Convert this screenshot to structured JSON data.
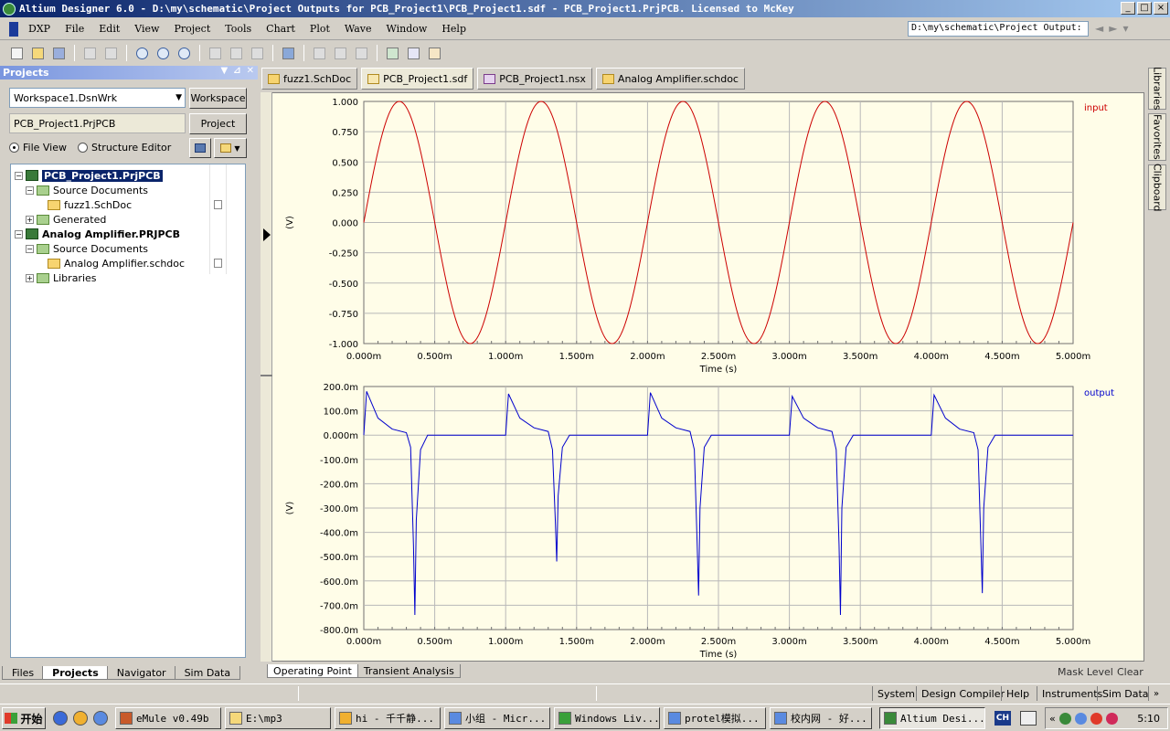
{
  "window": {
    "title": "Altium Designer 6.0 - D:\\my\\schematic\\Project Outputs for PCB_Project1\\PCB_Project1.sdf - PCB_Project1.PrjPCB. Licensed to McKey",
    "controls": [
      "_",
      "□",
      "×"
    ]
  },
  "menubar": {
    "items": [
      "DXP",
      "File",
      "Edit",
      "View",
      "Project",
      "Tools",
      "Chart",
      "Plot",
      "Wave",
      "Window",
      "Help"
    ],
    "path": "D:\\my\\schematic\\Project Output:"
  },
  "projects_panel": {
    "title": "Projects",
    "workspace_combo": "Workspace1.DsnWrk",
    "workspace_button": "Workspace",
    "project_field": "PCB_Project1.PrjPCB",
    "project_button": "Project",
    "radio_file_view": "File View",
    "radio_structure_editor": "Structure Editor",
    "tree": [
      {
        "label": "PCB_Project1.PrjPCB",
        "level": 0,
        "bold": true,
        "selected": true,
        "icon": "pcb-project-icon",
        "expander": "−"
      },
      {
        "label": "Source Documents",
        "level": 1,
        "icon": "folder-icon",
        "expander": "−"
      },
      {
        "label": "fuzz1.SchDoc",
        "level": 2,
        "icon": "schdoc-icon",
        "expander": ""
      },
      {
        "label": "Generated",
        "level": 1,
        "icon": "folder-icon",
        "expander": "+"
      },
      {
        "label": "Analog Amplifier.PRJPCB",
        "level": 0,
        "bold": true,
        "icon": "pcb-project-icon",
        "expander": "−"
      },
      {
        "label": "Source Documents",
        "level": 1,
        "icon": "folder-icon",
        "expander": "−"
      },
      {
        "label": "Analog Amplifier.schdoc",
        "level": 2,
        "icon": "schdoc-icon",
        "expander": ""
      },
      {
        "label": "Libraries",
        "level": 1,
        "icon": "folder-icon",
        "expander": "+"
      }
    ],
    "tabs": [
      "Files",
      "Projects",
      "Navigator",
      "Sim Data"
    ]
  },
  "doc_tabs": [
    "fuzz1.SchDoc",
    "PCB_Project1.sdf",
    "PCB_Project1.nsx",
    "Analog Amplifier.schdoc"
  ],
  "chart_tabs": [
    "Operating Point",
    "Transient Analysis"
  ],
  "mask_level": "Mask Level",
  "clear": "Clear",
  "right_rail": [
    "Libraries",
    "Favorites",
    "Clipboard"
  ],
  "statusbar": [
    "System",
    "Design Compiler",
    "Help",
    "Instruments",
    "Sim Data"
  ],
  "taskbar": {
    "start": "开始",
    "tasks": [
      "eMule v0.49b",
      "E:\\mp3",
      "hi - 千千静...",
      "小组 - Micr...",
      "Windows Liv...",
      "protel模拟...",
      "校内网 - 好...",
      "Altium Desi..."
    ],
    "lang": "CH",
    "clock": "5:10"
  },
  "chart_data": [
    {
      "type": "line",
      "series": [
        {
          "name": "input",
          "color": "#cc0000",
          "function": "sin(2*pi*1000*t)",
          "amplitude": 1.0,
          "frequency_hz": 1000
        }
      ],
      "xlabel": "Time (s)",
      "ylabel": "(V)",
      "xlim": [
        0,
        0.005
      ],
      "ylim": [
        -1.0,
        1.0
      ],
      "x_tick_labels": [
        "0.000m",
        "0.500m",
        "1.000m",
        "1.500m",
        "2.000m",
        "2.500m",
        "3.000m",
        "3.500m",
        "4.000m",
        "4.500m",
        "5.000m"
      ],
      "y_tick_labels": [
        "1.000",
        "0.750",
        "0.500",
        "0.250",
        "0.000",
        "-0.250",
        "-0.500",
        "-0.750",
        "-1.000"
      ],
      "grid": true,
      "legend": "top-right"
    },
    {
      "type": "line",
      "series": [
        {
          "name": "output",
          "color": "#0000cc",
          "x_ms": [
            0.0,
            0.02,
            0.1,
            0.2,
            0.3,
            0.33,
            0.35,
            0.36,
            0.37,
            0.4,
            0.45,
            1.0,
            1.02,
            1.1,
            1.2,
            1.3,
            1.33,
            1.35,
            1.36,
            1.37,
            1.4,
            1.45,
            2.0,
            2.02,
            2.1,
            2.2,
            2.3,
            2.33,
            2.35,
            2.36,
            2.37,
            2.4,
            2.45,
            3.0,
            3.02,
            3.1,
            3.2,
            3.3,
            3.33,
            3.35,
            3.36,
            3.37,
            3.4,
            3.45,
            4.0,
            4.02,
            4.1,
            4.2,
            4.3,
            4.33,
            4.35,
            4.36,
            4.37,
            4.4,
            4.45,
            5.0
          ],
          "y_mV": [
            0,
            180,
            70,
            25,
            10,
            -50,
            -450,
            -740,
            -350,
            -60,
            0,
            0,
            170,
            70,
            30,
            15,
            -60,
            -350,
            -520,
            -250,
            -50,
            0,
            0,
            175,
            70,
            30,
            15,
            -60,
            -450,
            -660,
            -300,
            -50,
            0,
            0,
            160,
            70,
            30,
            15,
            -60,
            -450,
            -740,
            -300,
            -50,
            0,
            0,
            165,
            70,
            25,
            10,
            -60,
            -450,
            -650,
            -300,
            -50,
            0,
            0
          ]
        }
      ],
      "xlabel": "Time (s)",
      "ylabel": "(V)",
      "xlim": [
        0,
        0.005
      ],
      "ylim": [
        -0.8,
        0.2
      ],
      "x_tick_labels": [
        "0.000m",
        "0.500m",
        "1.000m",
        "1.500m",
        "2.000m",
        "2.500m",
        "3.000m",
        "3.500m",
        "4.000m",
        "4.500m",
        "5.000m"
      ],
      "y_tick_labels": [
        "200.0m",
        "100.0m",
        "0.000m",
        "-100.0m",
        "-200.0m",
        "-300.0m",
        "-400.0m",
        "-500.0m",
        "-600.0m",
        "-700.0m",
        "-800.0m"
      ],
      "grid": true,
      "legend": "top-right"
    }
  ]
}
